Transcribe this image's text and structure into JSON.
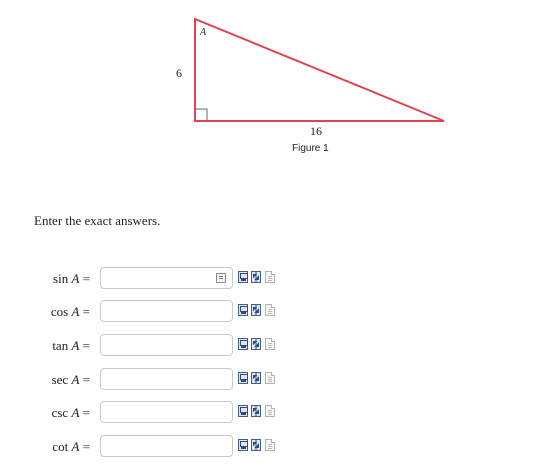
{
  "figure": {
    "vertex_label": "A",
    "side_vertical": "6",
    "side_horizontal": "16",
    "caption": "Figure 1",
    "line_color": "#e0454f"
  },
  "instructions": "Enter the exact answers.",
  "equals": "=",
  "rows": [
    {
      "fn": "sin",
      "var": "A",
      "value": "",
      "keyboard_icon": true
    },
    {
      "fn": "cos",
      "var": "A",
      "value": ""
    },
    {
      "fn": "tan",
      "var": "A",
      "value": ""
    },
    {
      "fn": "sec",
      "var": "A",
      "value": ""
    },
    {
      "fn": "csc",
      "var": "A",
      "value": ""
    },
    {
      "fn": "cot",
      "var": "A",
      "value": ""
    }
  ],
  "icons": [
    "equation-editor-icon",
    "statistics-icon",
    "notes-icon"
  ]
}
